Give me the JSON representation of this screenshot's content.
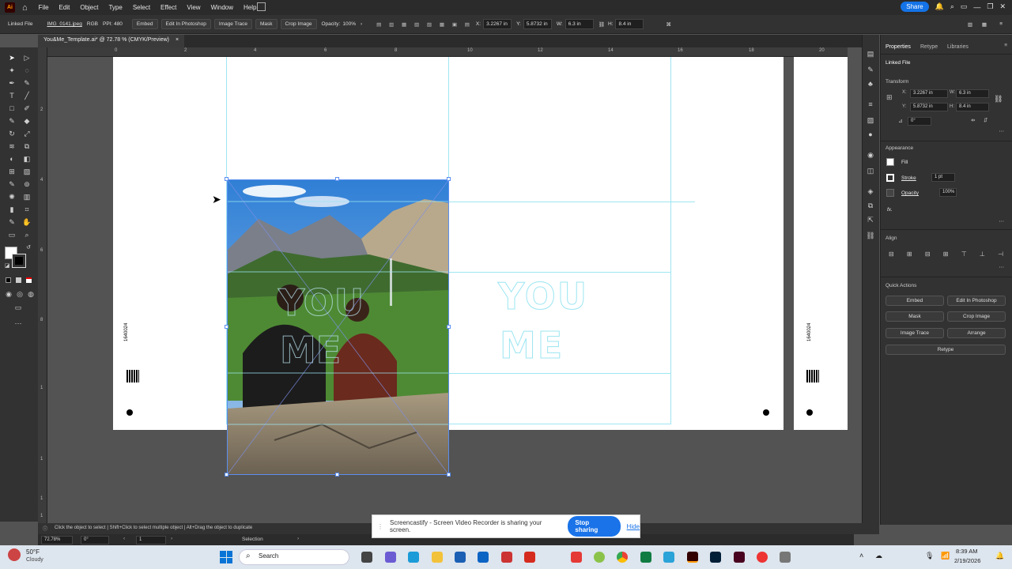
{
  "app": {
    "logo": "Ai",
    "menus": [
      "File",
      "Edit",
      "Object",
      "Type",
      "Select",
      "Effect",
      "View",
      "Window",
      "Help"
    ],
    "share_label": "Share"
  },
  "control_bar": {
    "linked_file": "Linked File",
    "filename": "IMG_0141.jpeg",
    "color_mode": "RGB",
    "ppi": "PPI: 480",
    "embed": "Embed",
    "edit_photoshop": "Edit In Photoshop",
    "image_trace": "Image Trace",
    "mask": "Mask",
    "crop_image": "Crop Image",
    "opacity_label": "Opacity:",
    "opacity_value": "100%",
    "x_label": "X:",
    "x_value": "3.2267 in",
    "y_label": "Y:",
    "y_value": "5.8732 in",
    "w_label": "W:",
    "w_value": "6.3 in",
    "h_label": "H:",
    "h_value": "8.4 in"
  },
  "document_tab": {
    "title": "You&Me_Template.ai* @ 72.78 % (CMYK/Preview)",
    "close": "×"
  },
  "ruler_top": [
    "0",
    "2",
    "4",
    "6",
    "8",
    "10",
    "12",
    "14",
    "16",
    "18",
    "20"
  ],
  "ruler_left": [
    "2",
    "4",
    "6",
    "8",
    "1",
    "1",
    "1",
    "1"
  ],
  "artboard": {
    "logo_line1": "YOU",
    "logo_line2": "ME",
    "code_left": "1640024",
    "code_right": "1640024"
  },
  "panel": {
    "tabs": [
      "Properties",
      "Retype",
      "Libraries"
    ],
    "linked_file": "Linked File",
    "transform": "Transform",
    "x": "3.2267 in",
    "y": "5.8732 in",
    "w": "6.3 in",
    "h": "8.4 in",
    "x_label": "X:",
    "y_label": "Y:",
    "w_label": "W:",
    "h_label": "H:",
    "angle": "0°",
    "appearance": "Appearance",
    "fill": "Fill",
    "stroke": "Stroke",
    "stroke_weight": "1 pt",
    "opacity": "Opacity",
    "opacity_value": "100%",
    "fx": "fx.",
    "align": "Align",
    "quick_actions": "Quick Actions",
    "qa_buttons": [
      "Embed",
      "Edit In Photoshop",
      "Mask",
      "Crop Image",
      "Image Trace",
      "Arrange",
      "Retype"
    ]
  },
  "status": {
    "hint": "Click the object to select  |  Shift+Click to select multiple object  |  Alt+Drag the object to duplicate"
  },
  "zoom": {
    "level": "72.78%",
    "rotation": "0°",
    "artboard": "1",
    "tool": "Selection"
  },
  "sharing": {
    "text": "Screencastify - Screen Video Recorder is sharing your screen.",
    "stop": "Stop sharing",
    "hide": "Hide"
  },
  "taskbar": {
    "weather_temp": "50°F",
    "weather_desc": "Cloudy",
    "search": "Search",
    "time": "8:39 AM",
    "date": "2/19/2026"
  },
  "colors": {
    "guide": "#9ee6f2",
    "accent": "#1473e6"
  }
}
